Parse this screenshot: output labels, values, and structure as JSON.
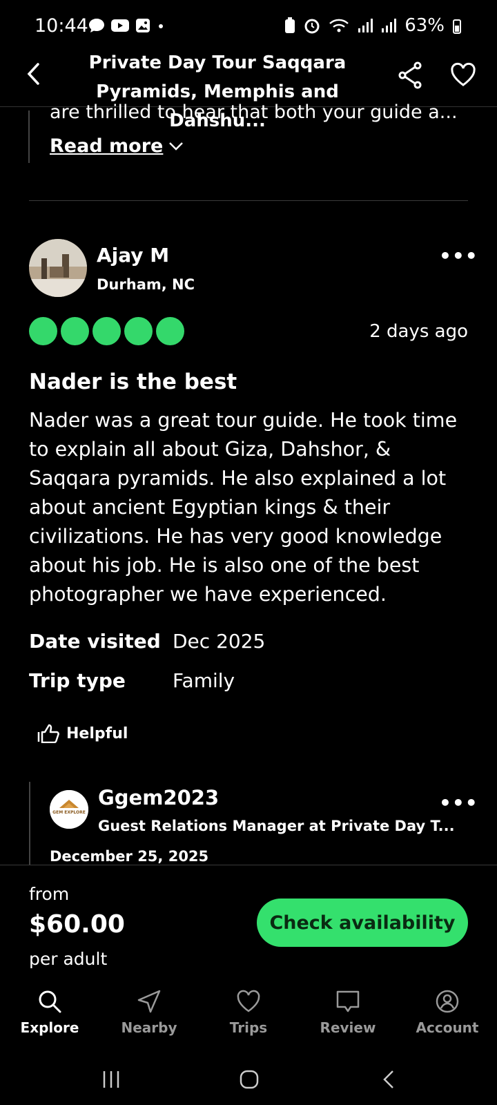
{
  "status_bar": {
    "time": "10:44",
    "battery": "63%"
  },
  "header": {
    "title_line1": "Private Day Tour Saqqara",
    "title_line2": "Pyramids, Memphis and Dahshu..."
  },
  "previous_review": {
    "text_tail": "are thrilled to hear that both your guide a...",
    "read_more": "Read more"
  },
  "review": {
    "author": "Ajay M",
    "location": "Durham, NC",
    "rating": 5,
    "date_ago": "2 days ago",
    "title": "Nader is the best",
    "body": "Nader was a great tour guide. He took time to explain all about Giza, Dahshor, & Saqqara pyramids. He also explained a lot about ancient Egyptian kings & their civilizations. He has very good knowledge about his job. He is also one of the best photographer we have experienced.",
    "date_visited_label": "Date visited",
    "date_visited": "Dec 2025",
    "trip_type_label": "Trip type",
    "trip_type": "Family",
    "helpful": "Helpful"
  },
  "reply": {
    "owner": "Ggem2023",
    "role": "Guest Relations Manager at Private Day T...",
    "date": "December 25, 2025",
    "logo_text": "GEM EXPLORE"
  },
  "booking": {
    "from": "from",
    "price": "$60.00",
    "per": "per adult",
    "cta": "Check availability"
  },
  "nav": [
    {
      "label": "Explore",
      "icon": "search-icon"
    },
    {
      "label": "Nearby",
      "icon": "navigation-arrow-icon"
    },
    {
      "label": "Trips",
      "icon": "heart-icon"
    },
    {
      "label": "Review",
      "icon": "review-bubble-icon"
    },
    {
      "label": "Account",
      "icon": "account-icon"
    }
  ],
  "colors": {
    "accent": "#34e06d",
    "rating": "#34d86b",
    "background": "#000000"
  }
}
